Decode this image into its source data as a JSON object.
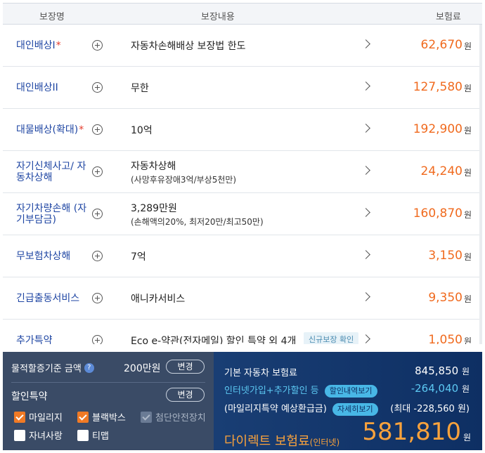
{
  "table": {
    "headers": {
      "name": "보장명",
      "content": "보장내용",
      "premium": "보험료"
    },
    "currency": "원",
    "rows": [
      {
        "name": "대인배상I",
        "required": "*",
        "desc": "자동차손해배상 보장법 한도",
        "sub": "",
        "amount": "62,670"
      },
      {
        "name": "대인배상II",
        "required": "",
        "desc": "무한",
        "sub": "",
        "amount": "127,580"
      },
      {
        "name": "대물배상(확대)",
        "required": "*",
        "desc": "10억",
        "sub": "",
        "amount": "192,900"
      },
      {
        "name": "자기신체사고/ 자동차상해",
        "required": "",
        "desc": "자동차상해",
        "sub": "(사망후유장애3억/부상5천만)",
        "amount": "24,240"
      },
      {
        "name": "자기차량손해 (자기부담금)",
        "required": "",
        "desc": "3,289만원",
        "sub": "(손해액의20%, 최저20만/최고50만)",
        "amount": "160,870"
      },
      {
        "name": "무보험차상해",
        "required": "",
        "desc": "7억",
        "sub": "",
        "amount": "3,150"
      },
      {
        "name": "긴급출동서비스",
        "required": "",
        "desc": "애니카서비스",
        "sub": "",
        "amount": "9,350"
      },
      {
        "name": "추가특약",
        "required": "",
        "desc": "Eco e-약관(전자메일) 할인 특약 외 4개",
        "sub": "",
        "amount": "1,050",
        "badge": "신규보장 확인"
      }
    ]
  },
  "left_panel": {
    "property_label": "물적할증기준 금액",
    "property_amount": "200만원",
    "change_label": "변경",
    "discount_title": "할인특약",
    "checkboxes": [
      {
        "label": "마일리지",
        "state": "checked"
      },
      {
        "label": "블랙박스",
        "state": "checked"
      },
      {
        "label": "첨단안전장치",
        "state": "disabled"
      },
      {
        "label": "자녀사랑",
        "state": "unchecked"
      },
      {
        "label": "티맵",
        "state": "unchecked"
      }
    ]
  },
  "right_panel": {
    "base_label": "기본 자동차 보험료",
    "base_value": "845,850",
    "discount_label": "인터넷가입+추가할인 등",
    "discount_pill": "할인내역보기",
    "discount_value": "-264,040",
    "mileage_label": "(마일리지특약 예상환급금)",
    "mileage_pill": "자세히보기",
    "mileage_value": "(최대 -228,560 원)",
    "final_label": "다이렉트 보험료",
    "final_suffix": "(인터넷)",
    "final_value": "581,810",
    "currency": "원",
    "colors": {
      "accent_orange": "#f9a23c",
      "accent_blue": "#5cc8f2"
    }
  }
}
